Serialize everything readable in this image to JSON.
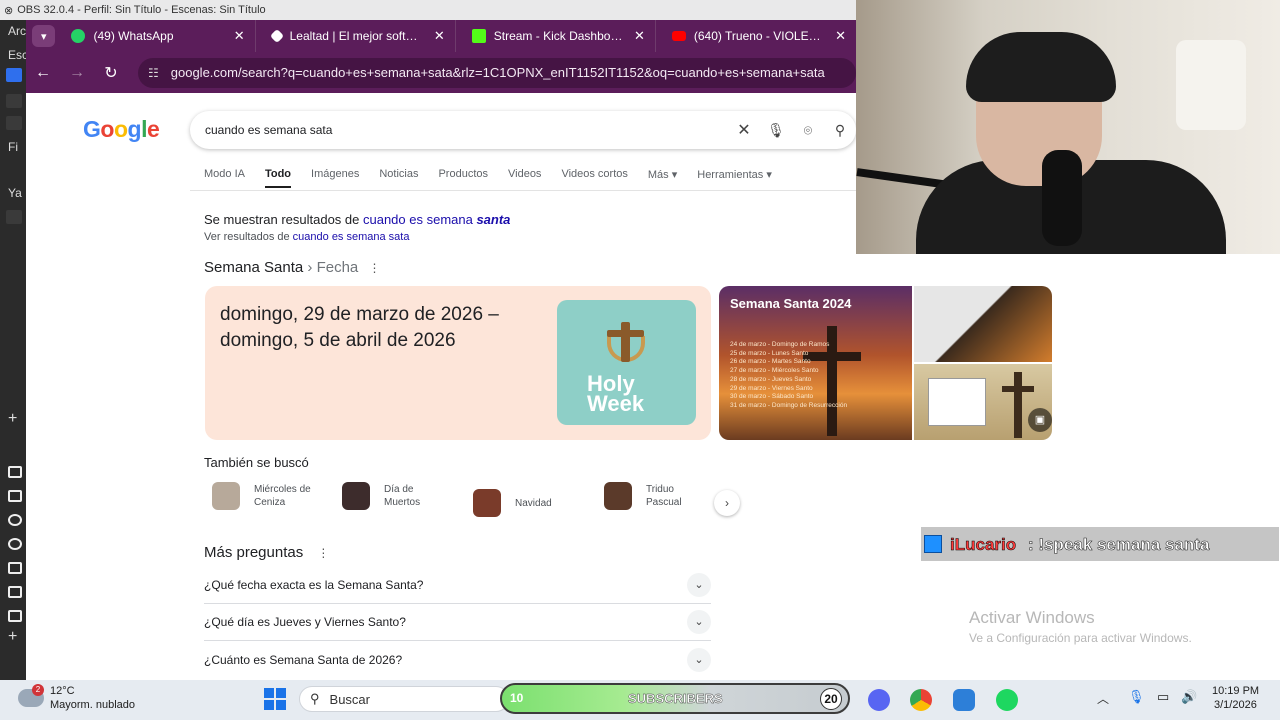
{
  "obs": {
    "title": "OBS 32.0.4 - Perfil: Sin Título - Escenas: Sin Título",
    "left_labels": [
      "Arc",
      "Esc",
      "Fi",
      "Ya"
    ]
  },
  "browser": {
    "tabs": [
      {
        "label": "(49) WhatsApp",
        "color": "#25d366",
        "badge": "49"
      },
      {
        "label": "Lealtad | El mejor software",
        "color": "#ffffff"
      },
      {
        "label": "Stream - Kick Dashboard",
        "color": "#53fc18"
      },
      {
        "label": "(640) Trueno - VIOLENTO",
        "color": "#ff0000"
      }
    ],
    "url": "google.com/search?q=cuando+es+semana+sata&rlz=1C1OPNX_enIT1152IT1152&oq=cuando+es+semana+sata"
  },
  "google": {
    "logo": "Google",
    "query": "cuando es semana sata",
    "tabs": [
      "Modo IA",
      "Todo",
      "Imágenes",
      "Noticias",
      "Productos",
      "Videos",
      "Videos cortos",
      "Más ▾",
      "Herramientas ▾"
    ],
    "active_tab": "Todo",
    "correction_prefix": "Se muestran resultados de ",
    "correction_link": "cuando es semana ",
    "correction_link_bold": "santa",
    "original_prefix": "Ver resultados de ",
    "original_link": "cuando es semana sata",
    "breadcrumb_main": "Semana Santa",
    "breadcrumb_sub": " › Fecha",
    "answer": "domingo, 29 de marzo de 2026 – domingo, 5 de abril de 2026",
    "holy_week_img_text": "Holy Week",
    "image1_title": "Semana Santa 2024",
    "image1_lines": [
      "24 de marzo - Domingo de Ramos",
      "25 de marzo - Lunes Santo",
      "26 de marzo - Martes Santo",
      "27 de marzo - Miércoles Santo",
      "28 de marzo - Jueves Santo",
      "29 de marzo - Viernes Santo",
      "30 de marzo - Sábado Santo",
      "31 de marzo - Domingo de Resurrección"
    ],
    "also_searched_title": "También se buscó",
    "related": [
      {
        "label": "Miércoles de Ceniza",
        "thumb": "#b7a99a"
      },
      {
        "label": "Día de Muertos",
        "thumb": "#3d2c2c"
      },
      {
        "label": "Navidad",
        "thumb": "#7a3b2a"
      },
      {
        "label": "Triduo Pascual",
        "thumb": "#5b3a2a"
      }
    ],
    "more_questions_title": "Más preguntas",
    "questions": [
      "¿Qué fecha exacta es la Semana Santa?",
      "¿Qué día es Jueves y Viernes Santo?",
      "¿Cuánto es Semana Santa de 2026?"
    ]
  },
  "chat_overlay": {
    "user": "iLucario",
    "message": ": !speak semana santa"
  },
  "activate_windows": {
    "title": "Activar Windows",
    "subtitle": "Ve a Configuración para activar Windows."
  },
  "taskbar": {
    "temperature": "12°C",
    "weather": "Mayorm. nublado",
    "weather_badge": "2",
    "search_placeholder": "Buscar",
    "subs_left": "10",
    "subs_label": "SUBSCRIBERS",
    "subs_right": "20",
    "time": "10:19 PM",
    "date": "3/1/2026"
  }
}
